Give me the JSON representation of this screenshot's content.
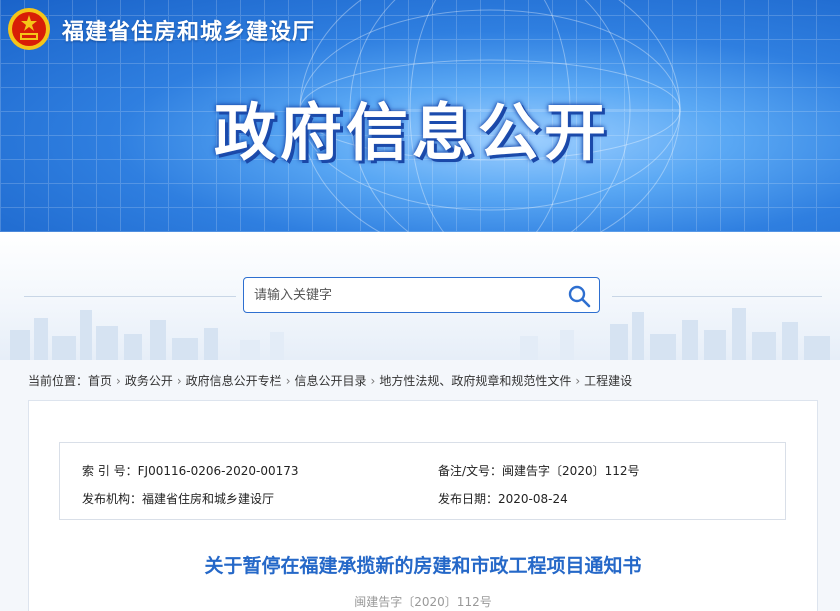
{
  "header": {
    "site_name": "福建省住房和城乡建设厅",
    "banner_title": "政府信息公开"
  },
  "search": {
    "placeholder": "请输入关键字"
  },
  "breadcrumb": {
    "label": "当前位置：",
    "items": [
      "首页",
      "政务公开",
      "政府信息公开专栏",
      "信息公开目录",
      "地方性法规、政府规章和规范性文件",
      "工程建设"
    ]
  },
  "meta": {
    "index_label": "索 引 号：",
    "index_value": "FJ00116-0206-2020-00173",
    "docno_label": "备注/文号：",
    "docno_value": "闽建告字〔2020〕112号",
    "org_label": "发布机构：",
    "org_value": "福建省住房和城乡建设厅",
    "date_label": "发布日期：",
    "date_value": "2020-08-24"
  },
  "document": {
    "title": "关于暂停在福建承揽新的房建和市政工程项目通知书",
    "number": "闽建告字〔2020〕112号"
  },
  "colors": {
    "accent": "#2568c8",
    "banner": "#2f7fe0",
    "emblem_red": "#d81e06",
    "emblem_gold": "#f5c518"
  }
}
